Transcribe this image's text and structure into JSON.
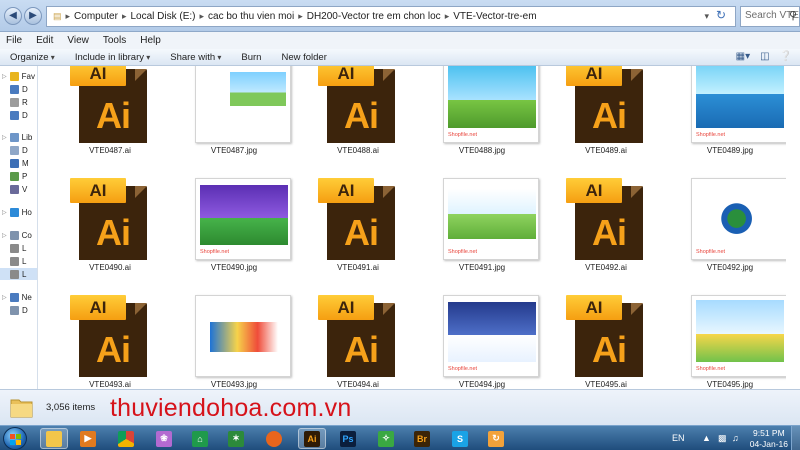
{
  "window": {
    "address_crumbs": [
      "Computer",
      "Local Disk (E:)",
      "cac bo thu vien moi",
      "DH200-Vector tre em chon loc",
      "VTE-Vector-tre-em"
    ],
    "search_placeholder": "Search VTE-..."
  },
  "menu": [
    "File",
    "Edit",
    "View",
    "Tools",
    "Help"
  ],
  "toolbar": {
    "organize": "Organize",
    "include": "Include in library",
    "share": "Share with",
    "burn": "Burn",
    "new_folder": "New folder"
  },
  "nav": {
    "items": [
      {
        "label": "Fav",
        "icon": "star-icon",
        "color": "#e8b41d"
      },
      {
        "label": "D",
        "icon": "desktop-icon",
        "color": "#4a7bbf"
      },
      {
        "label": "R",
        "icon": "recent-icon",
        "color": "#9c9c9c"
      },
      {
        "label": "D",
        "icon": "download-icon",
        "color": "#4a7bbf"
      },
      {
        "label": "Lib",
        "icon": "library-icon",
        "color": "#6e96c8"
      },
      {
        "label": "D",
        "icon": "documents-icon",
        "color": "#8fa7c7"
      },
      {
        "label": "M",
        "icon": "music-icon",
        "color": "#3c6fb6"
      },
      {
        "label": "P",
        "icon": "pictures-icon",
        "color": "#5a9a4a"
      },
      {
        "label": "V",
        "icon": "videos-icon",
        "color": "#6a6a9a"
      },
      {
        "label": "Ho",
        "icon": "homegroup-icon",
        "color": "#2c8ad8"
      },
      {
        "label": "Co",
        "icon": "computer-icon",
        "color": "#7f93ad"
      },
      {
        "label": "L",
        "icon": "drive-icon",
        "color": "#8a8a8a"
      },
      {
        "label": "L",
        "icon": "drive-icon",
        "color": "#8a8a8a"
      },
      {
        "label": "L",
        "icon": "drive-icon",
        "color": "#8a8a8a"
      },
      {
        "label": "Ne",
        "icon": "network-icon",
        "color": "#4a7bbf"
      },
      {
        "label": "D",
        "icon": "computer-icon",
        "color": "#7f93ad"
      }
    ]
  },
  "files": [
    {
      "name": "VTE0487.ai",
      "type": "ai"
    },
    {
      "name": "VTE0487.jpg",
      "type": "jpg",
      "theme": "sky",
      "watermark": ""
    },
    {
      "name": "VTE0488.ai",
      "type": "ai"
    },
    {
      "name": "VTE0488.jpg",
      "type": "jpg",
      "theme": "plane",
      "watermark": "Shopfile.net"
    },
    {
      "name": "VTE0489.ai",
      "type": "ai"
    },
    {
      "name": "VTE0489.jpg",
      "type": "jpg",
      "theme": "sea",
      "watermark": "Shopfile.net"
    },
    {
      "name": "VTE0490.ai",
      "type": "ai"
    },
    {
      "name": "VTE0490.jpg",
      "type": "jpg",
      "theme": "purple",
      "watermark": "Shopfile.net"
    },
    {
      "name": "VTE0491.ai",
      "type": "ai"
    },
    {
      "name": "VTE0491.jpg",
      "type": "jpg",
      "theme": "field",
      "watermark": "Shopfile.net"
    },
    {
      "name": "VTE0492.ai",
      "type": "ai"
    },
    {
      "name": "VTE0492.jpg",
      "type": "jpg",
      "theme": "space",
      "watermark": "Shopfile.net"
    },
    {
      "name": "VTE0493.ai",
      "type": "ai"
    },
    {
      "name": "VTE0493.jpg",
      "type": "jpg",
      "theme": "pencil",
      "watermark": ""
    },
    {
      "name": "VTE0494.ai",
      "type": "ai"
    },
    {
      "name": "VTE0494.jpg",
      "type": "jpg",
      "theme": "xmas",
      "watermark": "Shopfile.net"
    },
    {
      "name": "VTE0495.ai",
      "type": "ai"
    },
    {
      "name": "VTE0495.jpg",
      "type": "jpg",
      "theme": "grad",
      "watermark": "Shopfile.net"
    }
  ],
  "ai_icon": {
    "tab_text": "AI",
    "big_text": "Ai"
  },
  "status": {
    "count": "3,056 items",
    "brand": "thuviendohoa.com.vn"
  },
  "taskbar": {
    "apps": [
      {
        "icon": "explorer-icon",
        "glyph": "",
        "bg": "#f3c64a",
        "active": true
      },
      {
        "icon": "media-player-icon",
        "glyph": "▶",
        "bg": "#e07a1f",
        "active": false
      },
      {
        "icon": "chrome-icon",
        "glyph": "",
        "bg": "#e8e8e8",
        "active": false
      },
      {
        "icon": "cat-icon",
        "glyph": "❀",
        "bg": "#b36ad1",
        "active": false
      },
      {
        "icon": "home-icon",
        "glyph": "⌂",
        "bg": "#1f9a4b",
        "active": false
      },
      {
        "icon": "vector-tool-icon",
        "glyph": "✶",
        "bg": "#2c8a3a",
        "active": false
      },
      {
        "icon": "firefox-icon",
        "glyph": "",
        "bg": "#e8651c",
        "active": false
      },
      {
        "icon": "illustrator-icon",
        "glyph": "Ai",
        "bg": "#2f1b05",
        "active": true
      },
      {
        "icon": "photoshop-icon",
        "glyph": "Ps",
        "bg": "#0b1e3c",
        "active": false
      },
      {
        "icon": "corel-icon",
        "glyph": "✧",
        "bg": "#3aa842",
        "active": false
      },
      {
        "icon": "bridge-icon",
        "glyph": "Br",
        "bg": "#3b2407",
        "active": false
      },
      {
        "icon": "skype-icon",
        "glyph": "S",
        "bg": "#1aa3e6",
        "active": false
      },
      {
        "icon": "refresh-tool-icon",
        "glyph": "↻",
        "bg": "#f2a23a",
        "active": false
      }
    ],
    "lang": "EN",
    "time": "9:51 PM",
    "date": "04-Jan-16"
  }
}
